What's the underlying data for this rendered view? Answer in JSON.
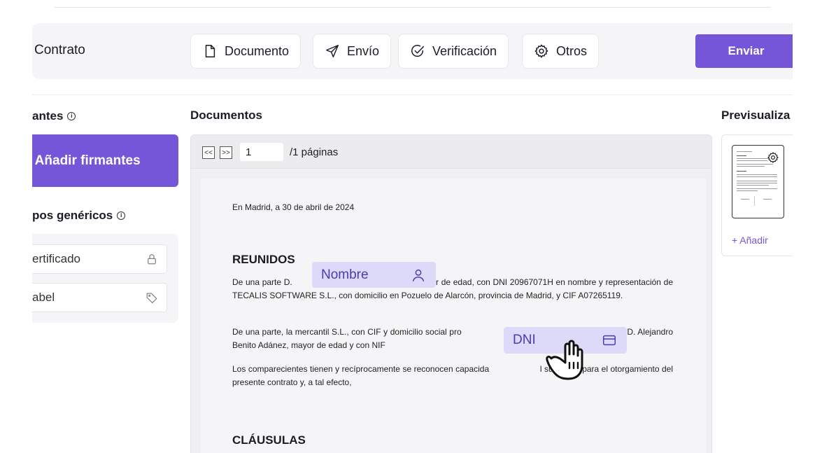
{
  "header": {
    "title": "Contrato",
    "tabs": [
      {
        "label": "Documento",
        "icon": "document-icon"
      },
      {
        "label": "Envío",
        "icon": "send-icon"
      },
      {
        "label": "Verificación",
        "icon": "check-circle-icon"
      },
      {
        "label": "Otros",
        "icon": "gear-icon"
      }
    ],
    "send_label": "Enviar"
  },
  "left": {
    "signers_title": "antes",
    "add_signers_label": "+ Añadir firmantes",
    "generic_fields_title": "pos genéricos",
    "fields": [
      {
        "label": "ertificado",
        "icon": "lock-icon"
      },
      {
        "label": "abel",
        "icon": "tag-icon"
      }
    ]
  },
  "documents": {
    "title": "Documentos",
    "pager": {
      "first": "<<",
      "last": ">>",
      "page": "1",
      "total": "/1 páginas"
    },
    "content": {
      "date_line": "En Madrid, a 30 de abril de 2024",
      "reunidos": "REUNIDOS",
      "para1": "De una parte D.                                              , mayor de edad, con DNI 20967071H en nombre y representación de TECALIS SOFTWARE S.L., con domicilio en Pozuelo de Alarcón, provincia de Madrid, y CIF A07265119.",
      "para2": "De una parte, la mercantil S.L., con CIF y domicilio social pro                                    da en este acto por D. Alejandro Benito Adánez, mayor de edad y con NIF",
      "para3": "Los comparecientes tienen y recíprocamente se reconocen capacida                     l suficiente para el otorgamiento del presente contrato y, a tal efecto,",
      "clausulas": "CLÁUSULAS"
    },
    "placed_fields": [
      {
        "label": "Nombre",
        "icon": "user-icon"
      },
      {
        "label": "DNI",
        "icon": "card-icon"
      }
    ]
  },
  "preview": {
    "title": "Previsualiza",
    "add_label": "+ Añadir"
  },
  "colors": {
    "accent": "#7556d9",
    "field_bg": "#dcdaf8",
    "field_text": "#4a3cb0"
  }
}
